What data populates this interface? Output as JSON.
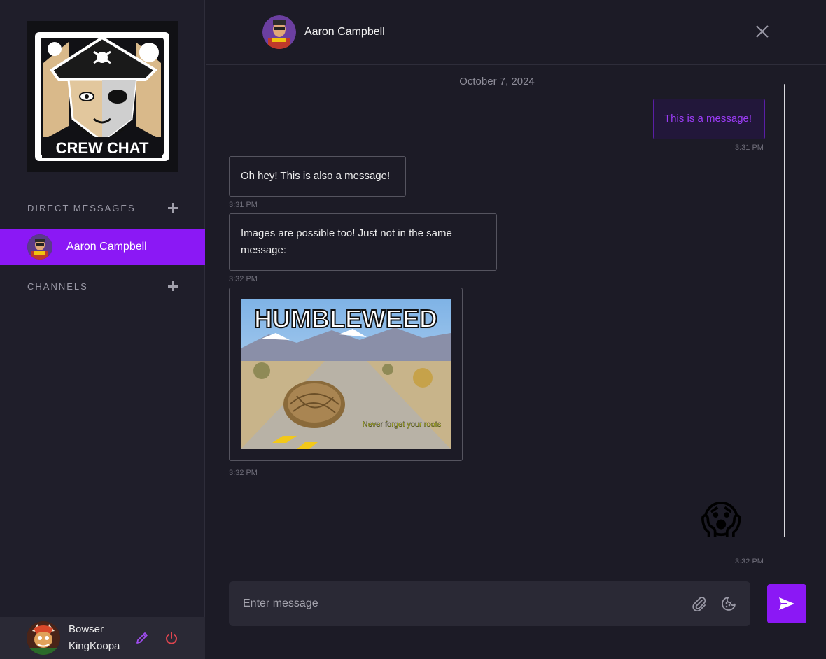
{
  "sidebar": {
    "logo_text": "CREW CHAT",
    "sections": {
      "direct_messages": "DIRECT MESSAGES",
      "channels": "CHANNELS"
    },
    "dm_items": [
      {
        "label": "Aaron Campbell"
      }
    ],
    "current_user": {
      "first_line": "Bowser",
      "second_line": "KingKoopa"
    }
  },
  "header": {
    "contact_name": "Aaron Campbell"
  },
  "messages": {
    "date": "October 7, 2024",
    "items": [
      {
        "from": "me",
        "text": "This is a message!",
        "time": "3:31 PM"
      },
      {
        "from": "them",
        "text": "Oh hey! This is also a message!",
        "time": "3:31 PM"
      },
      {
        "from": "them",
        "text": "Images are possible too! Just not in the same message:",
        "time": "3:32 PM"
      },
      {
        "from": "them",
        "type": "image",
        "time": "3:32 PM",
        "image": {
          "title": "HUMBLEWEED",
          "caption": "Never forget your roots"
        }
      },
      {
        "from": "me",
        "type": "emoji",
        "text": "😱",
        "time": "3:32 PM"
      }
    ]
  },
  "composer": {
    "placeholder": "Enter message",
    "value": ""
  },
  "icons": {
    "add_dm": "plus-icon",
    "add_channel": "plus-icon",
    "close": "close-icon",
    "edit": "pencil-icon",
    "logout": "power-icon",
    "attach": "paperclip-icon",
    "emoji": "emoji-icon",
    "send": "send-icon"
  },
  "colors": {
    "accent": "#8b18f5",
    "background": "#1c1b26",
    "sidebar": "#1f1e2a",
    "logout": "#e0454f",
    "edit": "#a04cf0"
  }
}
